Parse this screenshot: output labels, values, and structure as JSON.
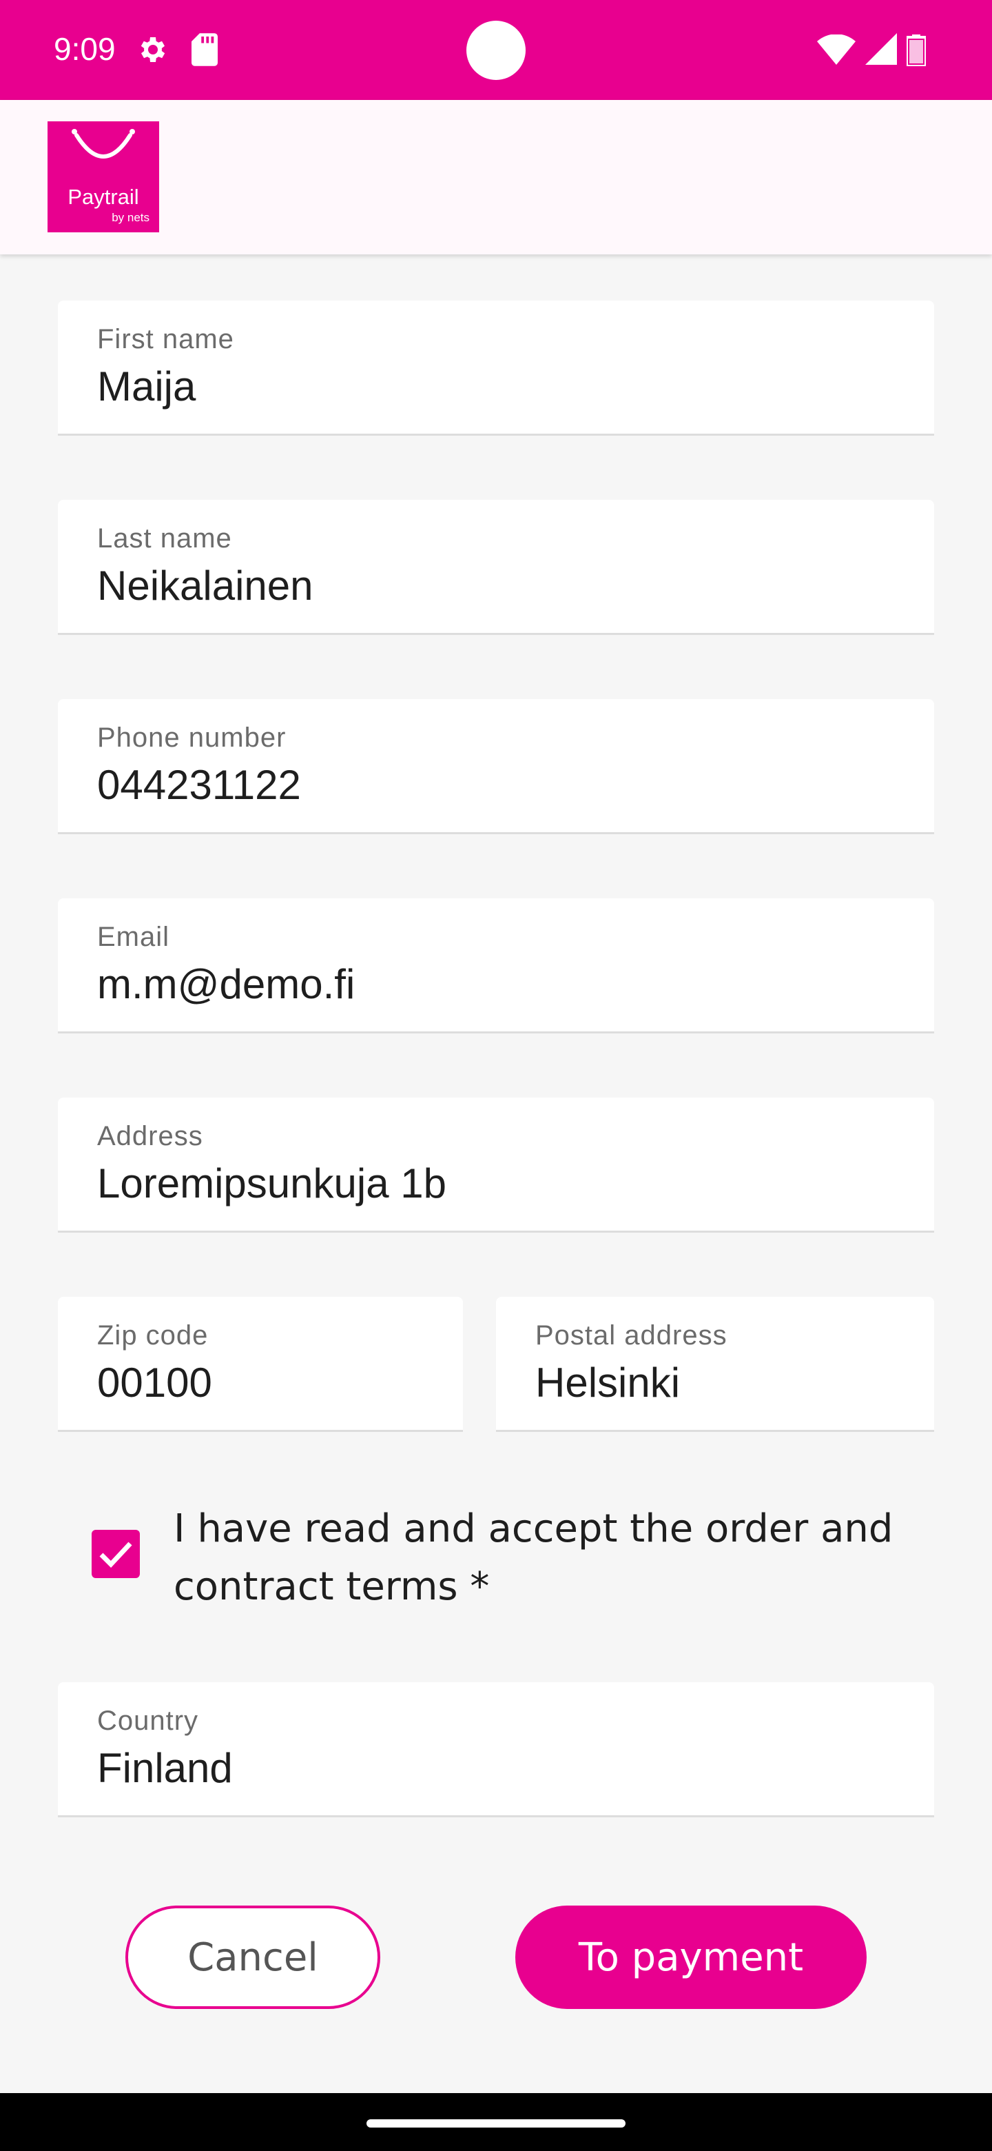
{
  "status_bar": {
    "time": "9:09",
    "icons": [
      "settings-gear-icon",
      "sd-card-icon",
      "wifi-icon",
      "cell-signal-icon",
      "battery-icon"
    ]
  },
  "app_bar": {
    "logo_text": "Paytrail",
    "logo_subtext": "by nets"
  },
  "form": {
    "first_name": {
      "label": "First name",
      "value": "Maija"
    },
    "last_name": {
      "label": "Last name",
      "value": "Neikalainen"
    },
    "phone": {
      "label": "Phone number",
      "value": "044231122"
    },
    "email": {
      "label": "Email",
      "value": "m.m@demo.fi"
    },
    "address": {
      "label": "Address",
      "value": "Loremipsunkuja 1b"
    },
    "zip": {
      "label": "Zip code",
      "value": "00100"
    },
    "postal": {
      "label": "Postal address",
      "value": "Helsinki"
    },
    "terms": {
      "label": "I have read and accept the order and contract terms *",
      "checked": true
    },
    "country": {
      "label": "Country",
      "value": "Finland"
    }
  },
  "buttons": {
    "cancel": "Cancel",
    "to_payment": "To payment"
  },
  "colors": {
    "brand": "#e8008f",
    "background": "#f6f6f6"
  }
}
